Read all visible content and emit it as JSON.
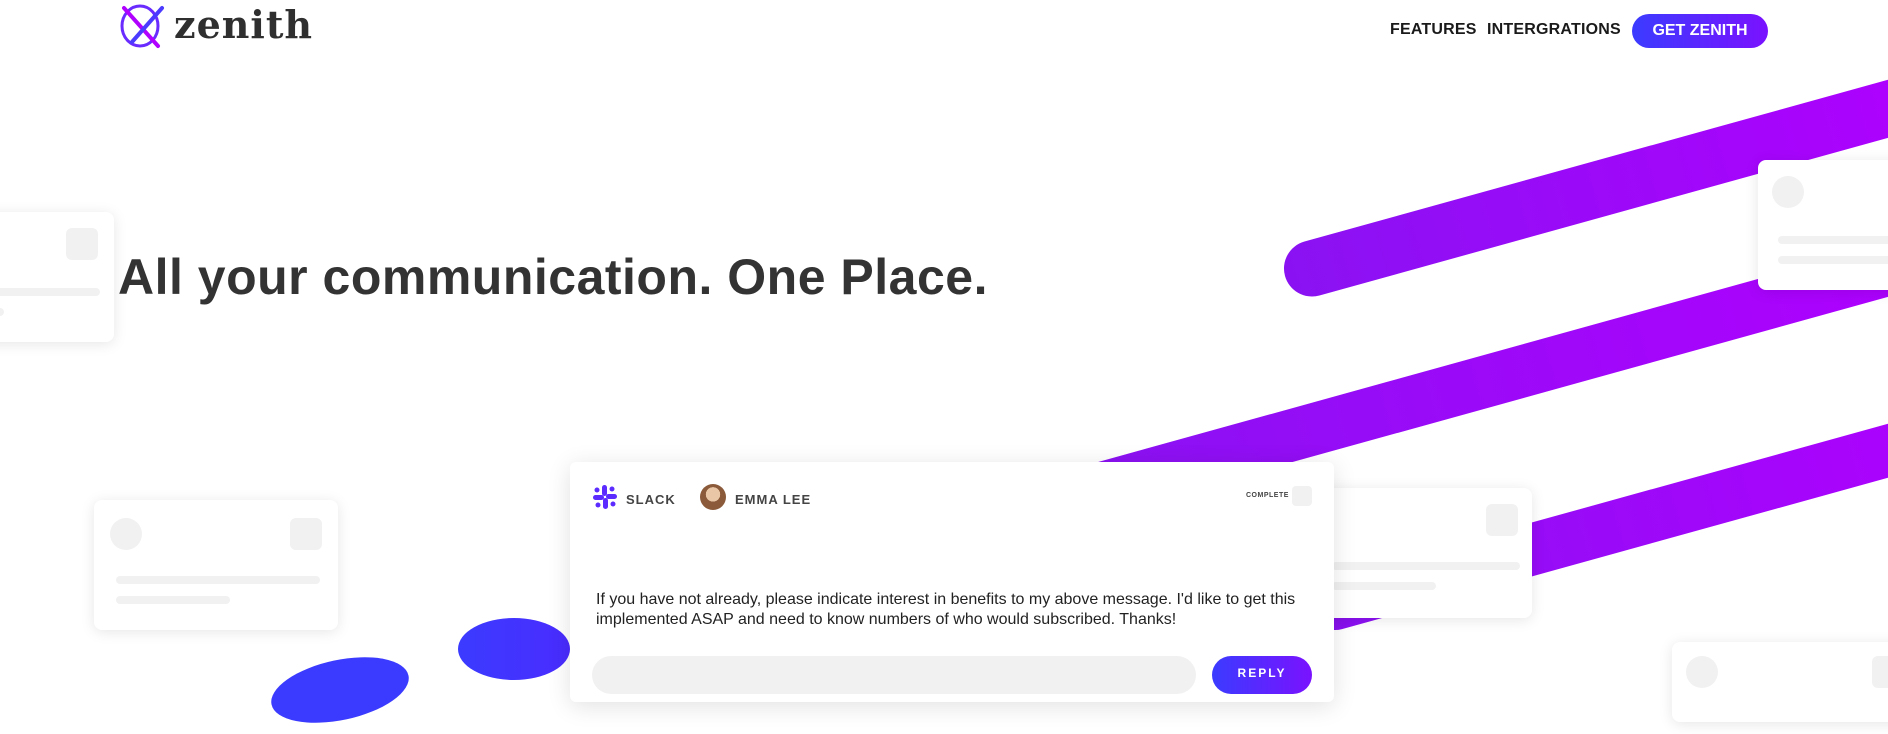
{
  "brand": {
    "name": "zenith",
    "accent_start": "#3b3bff",
    "accent_end": "#7a12ff",
    "stripe_color": "#a100ff"
  },
  "nav": {
    "links": [
      {
        "label": "FEATURES"
      },
      {
        "label": "INTERGRATIONS"
      }
    ],
    "cta_label": "GET ZENITH"
  },
  "hero": {
    "title": "All your communication. One Place."
  },
  "message_card": {
    "source_icon": "slack-icon",
    "source_label": "SLACK",
    "user_name": "EMMA LEE",
    "status_label": "COMPLETE",
    "message": "If you have not already, please indicate interest in benefits to my above message. I'd like to get this implemented ASAP and need to know numbers of who would subscribed. Thanks!",
    "reply_label": "REPLY"
  }
}
